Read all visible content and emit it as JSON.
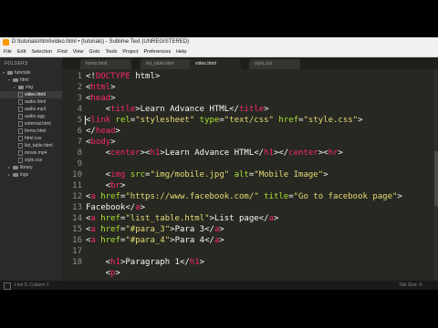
{
  "window": {
    "title": "D:\\tutorials\\html\\video.html • (tutorials) - Sublime Text (UNREGISTERED)"
  },
  "menu": [
    "File",
    "Edit",
    "Selection",
    "Find",
    "View",
    "Goto",
    "Tools",
    "Project",
    "Preferences",
    "Help"
  ],
  "sidebar": {
    "title": "FOLDERS",
    "items": [
      {
        "label": "tutorials",
        "kind": "folder",
        "depth": 0,
        "expanded": true
      },
      {
        "label": "html",
        "kind": "folder",
        "depth": 1,
        "expanded": true
      },
      {
        "label": "img",
        "kind": "folder",
        "depth": 2,
        "expanded": false
      },
      {
        "label": "video.html",
        "kind": "file",
        "depth": 2,
        "selected": true
      },
      {
        "label": "audio.html",
        "kind": "file",
        "depth": 2
      },
      {
        "label": "audio.mp3",
        "kind": "file",
        "depth": 2
      },
      {
        "label": "audio.ogg",
        "kind": "file",
        "depth": 2
      },
      {
        "label": "external.html",
        "kind": "file",
        "depth": 2
      },
      {
        "label": "forms.html",
        "kind": "file",
        "depth": 2
      },
      {
        "label": "html.css",
        "kind": "file",
        "depth": 2
      },
      {
        "label": "list_table.html",
        "kind": "file",
        "depth": 2
      },
      {
        "label": "movie.mp4",
        "kind": "file",
        "depth": 2
      },
      {
        "label": "style.css",
        "kind": "file",
        "depth": 2
      },
      {
        "label": "library",
        "kind": "folder",
        "depth": 1,
        "expanded": false
      },
      {
        "label": "logs",
        "kind": "folder",
        "depth": 1,
        "expanded": false
      }
    ]
  },
  "tabs": [
    {
      "label": "forms.html",
      "active": false
    },
    {
      "label": "list_table.html",
      "active": false
    },
    {
      "label": "video.html",
      "active": true
    },
    {
      "label": "style.css",
      "active": false
    }
  ],
  "editor": {
    "line_numbers": [
      "1",
      "2",
      "3",
      "4",
      "5",
      "6",
      "7",
      "8",
      "9",
      "10",
      "11",
      "12",
      "13",
      "14",
      "15",
      "16",
      "17",
      "18"
    ],
    "lines": [
      [
        [
          "p",
          "<!"
        ],
        [
          "t",
          "DOCTYPE"
        ],
        [
          "p",
          " html>"
        ]
      ],
      [
        [
          "p",
          "<"
        ],
        [
          "t",
          "html"
        ],
        [
          "p",
          ">"
        ]
      ],
      [
        [
          "p",
          "<"
        ],
        [
          "t",
          "head"
        ],
        [
          "p",
          ">"
        ]
      ],
      [
        [
          "p",
          "    <"
        ],
        [
          "t",
          "title"
        ],
        [
          "p",
          ">Learn Advance HTML</"
        ],
        [
          "t",
          "title"
        ],
        [
          "p",
          ">"
        ]
      ],
      [
        [
          "p",
          "<"
        ],
        [
          "t",
          "link"
        ],
        [
          "p",
          " "
        ],
        [
          "a",
          "rel"
        ],
        [
          "p",
          "="
        ],
        [
          "s",
          "\"stylesheet\""
        ],
        [
          "p",
          " "
        ],
        [
          "a",
          "type"
        ],
        [
          "p",
          "="
        ],
        [
          "s",
          "\"text/css\""
        ],
        [
          "p",
          " "
        ],
        [
          "a",
          "href"
        ],
        [
          "p",
          "="
        ],
        [
          "s",
          "\"style.css\""
        ],
        [
          "p",
          ">"
        ]
      ],
      [
        [
          "p",
          "</"
        ],
        [
          "t",
          "head"
        ],
        [
          "p",
          ">"
        ]
      ],
      [
        [
          "p",
          "<"
        ],
        [
          "t",
          "body"
        ],
        [
          "p",
          ">"
        ]
      ],
      [
        [
          "p",
          "    <"
        ],
        [
          "t",
          "center"
        ],
        [
          "p",
          "><"
        ],
        [
          "t",
          "h1"
        ],
        [
          "p",
          ">Learn Advance HTML</"
        ],
        [
          "t",
          "h1"
        ],
        [
          "p",
          "></"
        ],
        [
          "t",
          "center"
        ],
        [
          "p",
          "><"
        ],
        [
          "t",
          "hr"
        ],
        [
          "p",
          ">"
        ]
      ],
      [],
      [
        [
          "p",
          "    <"
        ],
        [
          "t",
          "img"
        ],
        [
          "p",
          " "
        ],
        [
          "a",
          "src"
        ],
        [
          "p",
          "="
        ],
        [
          "s",
          "\"img/mobile.jpg\""
        ],
        [
          "p",
          " "
        ],
        [
          "a",
          "alt"
        ],
        [
          "p",
          "="
        ],
        [
          "s",
          "\"Mobile Image\""
        ],
        [
          "p",
          ">"
        ]
      ],
      [
        [
          "p",
          "    <"
        ],
        [
          "t",
          "br"
        ],
        [
          "p",
          ">"
        ]
      ],
      [
        [
          "p",
          "<"
        ],
        [
          "t",
          "a"
        ],
        [
          "p",
          " "
        ],
        [
          "a",
          "href"
        ],
        [
          "p",
          "="
        ],
        [
          "s",
          "\"https://www.facebook.com/\""
        ],
        [
          "p",
          " "
        ],
        [
          "a",
          "title"
        ],
        [
          "p",
          "="
        ],
        [
          "s",
          "\"Go to facebook page\""
        ],
        [
          "p",
          ">"
        ]
      ],
      [
        [
          "p",
          "Facebook</"
        ],
        [
          "t",
          "a"
        ],
        [
          "p",
          ">"
        ]
      ],
      [
        [
          "p",
          "<"
        ],
        [
          "t",
          "a"
        ],
        [
          "p",
          " "
        ],
        [
          "a",
          "href"
        ],
        [
          "p",
          "="
        ],
        [
          "s",
          "\"list_table.html\""
        ],
        [
          "p",
          ">List page</"
        ],
        [
          "t",
          "a"
        ],
        [
          "p",
          ">"
        ]
      ],
      [
        [
          "p",
          "<"
        ],
        [
          "t",
          "a"
        ],
        [
          "p",
          " "
        ],
        [
          "a",
          "href"
        ],
        [
          "p",
          "="
        ],
        [
          "s",
          "\"#para_3\""
        ],
        [
          "p",
          ">Para 3</"
        ],
        [
          "t",
          "a"
        ],
        [
          "p",
          ">"
        ]
      ],
      [
        [
          "p",
          "<"
        ],
        [
          "t",
          "a"
        ],
        [
          "p",
          " "
        ],
        [
          "a",
          "href"
        ],
        [
          "p",
          "="
        ],
        [
          "s",
          "\"#para_4\""
        ],
        [
          "p",
          ">Para 4</"
        ],
        [
          "t",
          "a"
        ],
        [
          "p",
          ">"
        ]
      ],
      [],
      [
        [
          "p",
          "    <"
        ],
        [
          "t",
          "h1"
        ],
        [
          "p",
          ">Paragraph 1</"
        ],
        [
          "t",
          "h1"
        ],
        [
          "p",
          ">"
        ]
      ],
      [
        [
          "p",
          "    <"
        ],
        [
          "t",
          "p"
        ],
        [
          "p",
          ">"
        ]
      ]
    ]
  },
  "status": {
    "left": "Line 5, Column 1",
    "right": "Tab Size: 4"
  },
  "colors": {
    "tag": "#f92672",
    "attribute": "#a6e22e",
    "string": "#e6db74",
    "text": "#f8f8f2",
    "background": "#272822"
  }
}
